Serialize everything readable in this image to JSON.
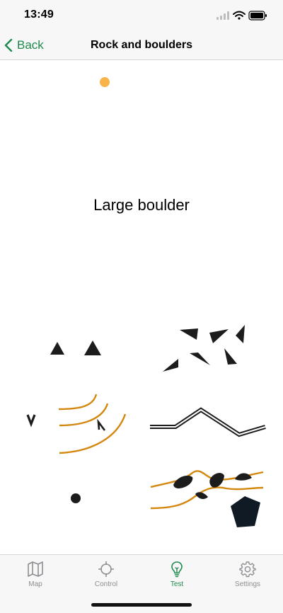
{
  "status_bar": {
    "time": "13:49"
  },
  "nav": {
    "back_label": "Back",
    "title": "Rock and boulders"
  },
  "question": {
    "text": "Large boulder",
    "progress_dot_color": "#f6b44a"
  },
  "answers": [
    {
      "symbol": "boulder-pair"
    },
    {
      "symbol": "boulder-field"
    },
    {
      "symbol": "rocky-pit-with-contours"
    },
    {
      "symbol": "passable-rock-face"
    },
    {
      "symbol": "small-boulder"
    },
    {
      "symbol": "boulders-on-contours-with-gigantic-boulder"
    }
  ],
  "colors": {
    "accent": "#1e8a4c",
    "contour": "#d4870e",
    "symbol": "#1c1c1c",
    "inactive_tab": "#8e8e93"
  },
  "tabs": [
    {
      "label": "Map",
      "icon": "map-icon",
      "active": false
    },
    {
      "label": "Control",
      "icon": "crosshair-icon",
      "active": false
    },
    {
      "label": "Test",
      "icon": "lightbulb-icon",
      "active": true
    },
    {
      "label": "Settings",
      "icon": "gear-icon",
      "active": false
    }
  ]
}
